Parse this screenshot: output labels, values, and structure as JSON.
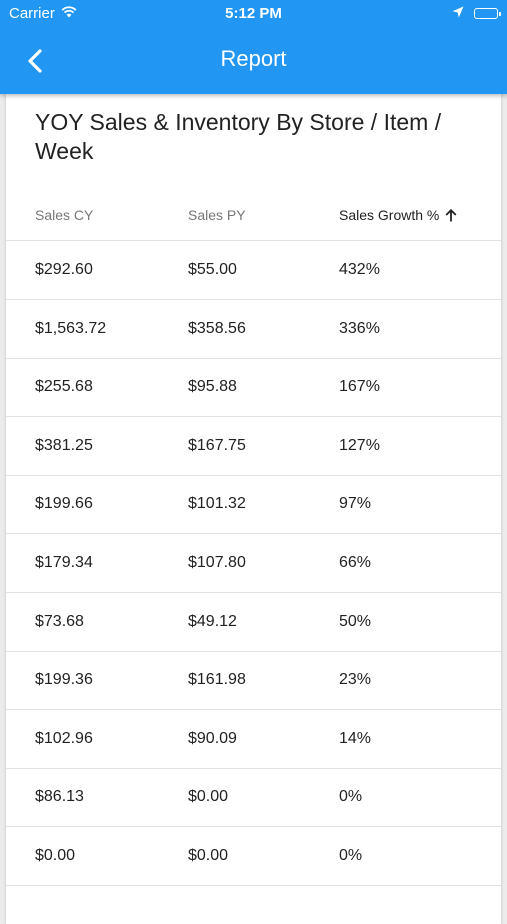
{
  "status_bar": {
    "carrier": "Carrier",
    "time": "5:12 PM"
  },
  "app_bar": {
    "title": "Report"
  },
  "report": {
    "title": "YOY Sales & Inventory By Store / Item / Week",
    "columns": [
      "Sales CY",
      "Sales PY",
      "Sales Growth %"
    ],
    "sort_column": "Sales Growth %",
    "sort_direction": "ascending",
    "rows": [
      [
        "$292.60",
        "$55.00",
        "432%"
      ],
      [
        "$1,563.72",
        "$358.56",
        "336%"
      ],
      [
        "$255.68",
        "$95.88",
        "167%"
      ],
      [
        "$381.25",
        "$167.75",
        "127%"
      ],
      [
        "$199.66",
        "$101.32",
        "97%"
      ],
      [
        "$179.34",
        "$107.80",
        "66%"
      ],
      [
        "$73.68",
        "$49.12",
        "50%"
      ],
      [
        "$199.36",
        "$161.98",
        "23%"
      ],
      [
        "$102.96",
        "$90.09",
        "14%"
      ],
      [
        "$86.13",
        "$0.00",
        "0%"
      ],
      [
        "$0.00",
        "$0.00",
        "0%"
      ]
    ]
  },
  "colors": {
    "app_bar": "#2196f3",
    "background": "#ececec",
    "card": "#ffffff"
  }
}
